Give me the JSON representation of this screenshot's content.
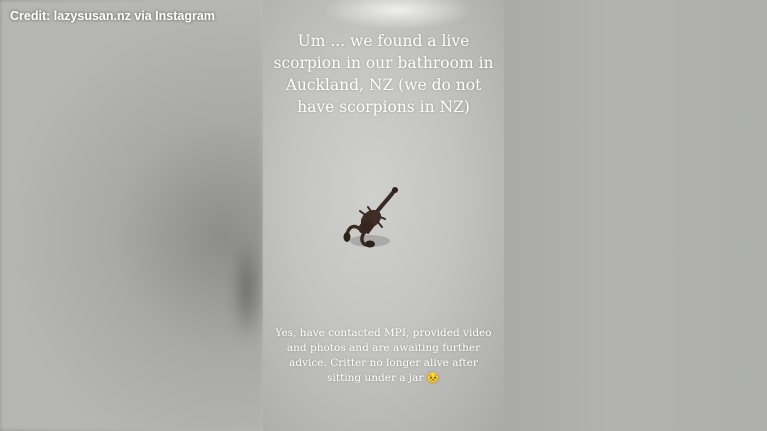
{
  "credit": "Credit: lazysusan.nz via Instagram",
  "caption_top": "Um ... we found a live scorpion in our bathroom in Auckland, NZ (we do not have scorpions in NZ)",
  "caption_bottom": "Yes, have contacted MPI, provided video and photos and are awaiting further advice. Critter no longer alive after sitting under a jar 😣",
  "colors": {
    "floor": "#c3c4c1",
    "scorpion": "#3a2a24",
    "text": "#ffffff"
  }
}
